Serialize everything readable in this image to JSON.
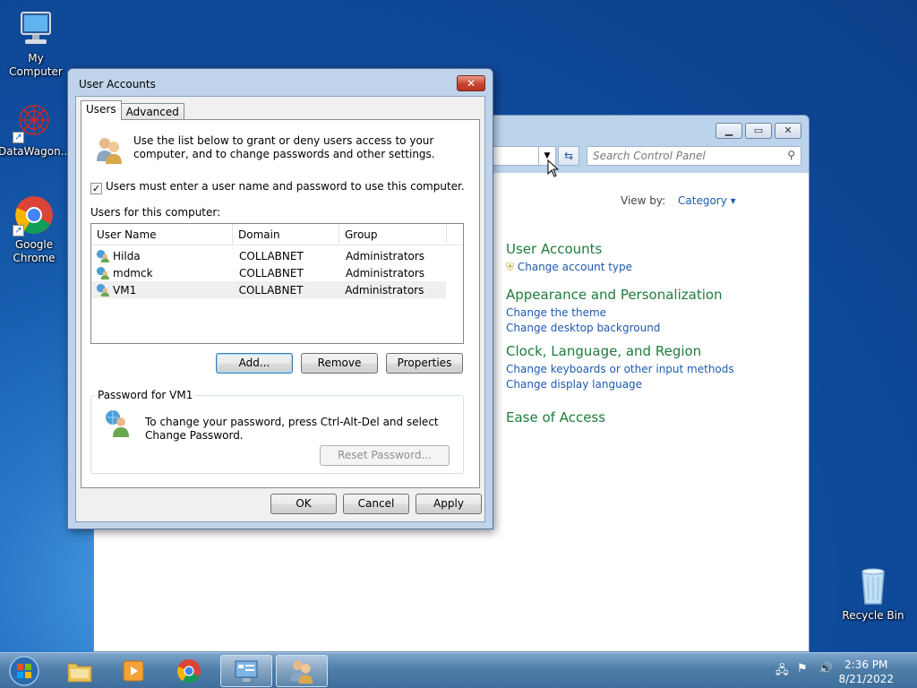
{
  "desktop": {
    "icons": [
      {
        "label": "My Computer"
      },
      {
        "label": "DataWagon..."
      },
      {
        "label": "Google Chrome"
      },
      {
        "label": "Recycle Bin"
      }
    ]
  },
  "control_panel": {
    "search_placeholder": "Search Control Panel",
    "view_by_label": "View by:",
    "view_by_value": "Category",
    "groups": [
      {
        "heading": "User Accounts",
        "links": [
          "Change account type"
        ]
      },
      {
        "heading": "Appearance and Personalization",
        "links": [
          "Change the theme",
          "Change desktop background"
        ]
      },
      {
        "heading": "Clock, Language, and Region",
        "links": [
          "Change keyboards or other input methods",
          "Change display language"
        ]
      },
      {
        "heading": "Ease of Access",
        "links": []
      }
    ]
  },
  "dialog": {
    "title": "User Accounts",
    "tabs": [
      "Users",
      "Advanced"
    ],
    "intro_text": "Use the list below to grant or deny users access to your computer, and to change passwords and other settings.",
    "checkbox_label": "Users must enter a user name and password to use this computer.",
    "checkbox_checked": true,
    "list_label": "Users for this computer:",
    "columns": [
      "User Name",
      "Domain",
      "Group"
    ],
    "users": [
      {
        "name": "Hilda",
        "domain": "COLLABNET",
        "group": "Administrators"
      },
      {
        "name": "mdmck",
        "domain": "COLLABNET",
        "group": "Administrators"
      },
      {
        "name": "VM1",
        "domain": "COLLABNET",
        "group": "Administrators"
      }
    ],
    "buttons": {
      "add": "Add...",
      "remove": "Remove",
      "properties": "Properties"
    },
    "password_group_label": "Password for VM1",
    "password_text": "To change your password, press Ctrl-Alt-Del and select Change Password.",
    "reset_password": "Reset Password...",
    "footer": {
      "ok": "OK",
      "cancel": "Cancel",
      "apply": "Apply"
    }
  },
  "taskbar": {
    "time": "2:36 PM",
    "date": "8/21/2022"
  },
  "colors": {
    "link": "#1e5ab0",
    "heading_green": "#1e7b3c",
    "taskbar": "#4f7ea8"
  }
}
